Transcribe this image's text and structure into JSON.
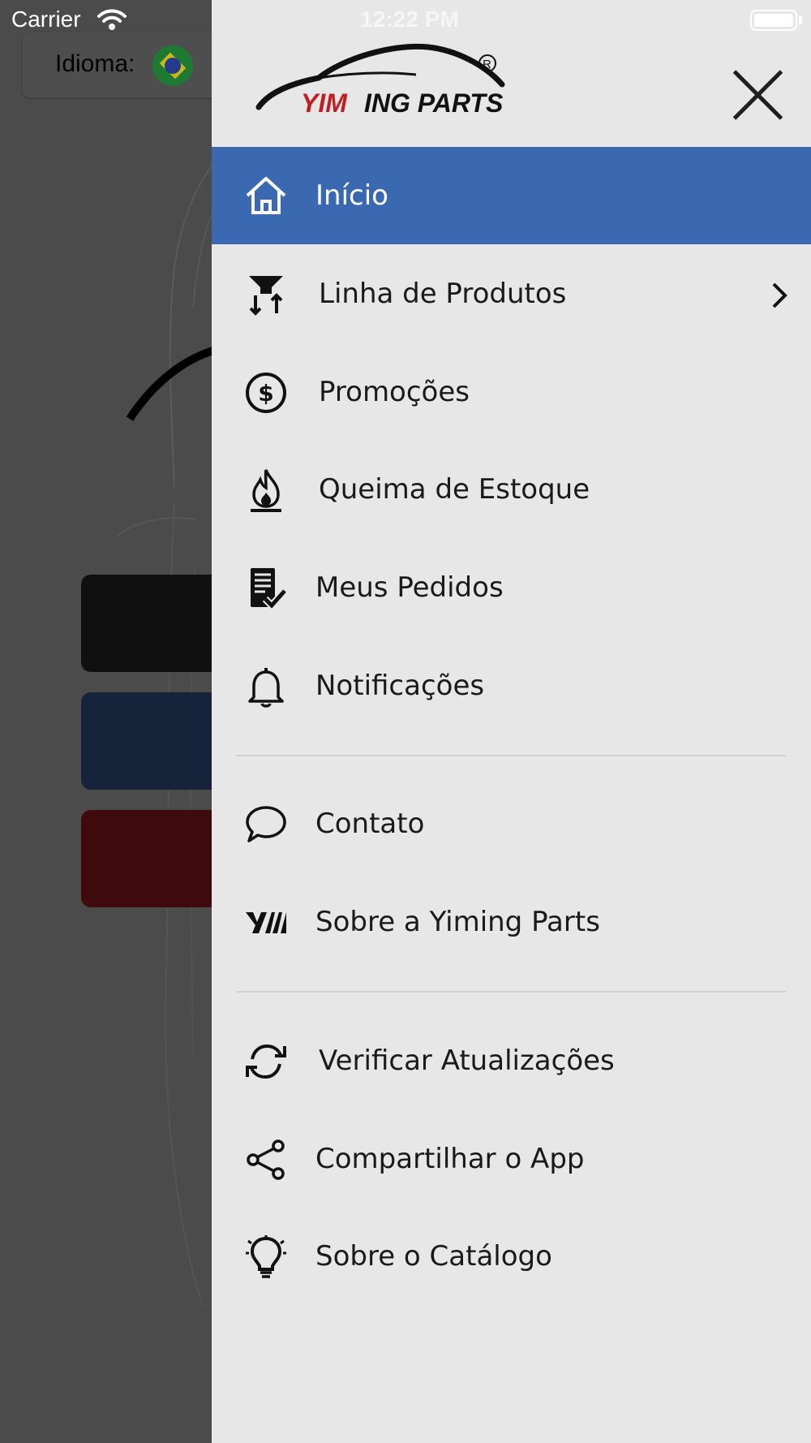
{
  "status_bar": {
    "carrier": "Carrier",
    "time": "12:22 PM"
  },
  "background": {
    "language_label": "Idioma:",
    "flag_icon": "brazil-flag-icon"
  },
  "drawer": {
    "logo_text": "YIMING PARTS",
    "logo_mark": "®",
    "close_icon": "close-icon",
    "items": [
      {
        "label": "Início",
        "icon": "home-icon",
        "active": true
      },
      {
        "label": "Linha de Produtos",
        "icon": "filter-sort-icon",
        "has_submenu": true
      },
      {
        "label": "Promoções",
        "icon": "dollar-circle-icon"
      },
      {
        "label": "Queima de Estoque",
        "icon": "flame-icon"
      },
      {
        "label": "Meus Pedidos",
        "icon": "checklist-icon"
      },
      {
        "label": "Notificações",
        "icon": "bell-icon"
      },
      {
        "label": "Contato",
        "icon": "chat-bubble-icon"
      },
      {
        "label": "Sobre a Yiming Parts",
        "icon": "ym-logo-icon"
      },
      {
        "label": "Verificar Atualizações",
        "icon": "refresh-icon"
      },
      {
        "label": "Compartilhar o App",
        "icon": "share-icon"
      },
      {
        "label": "Sobre o Catálogo",
        "icon": "lightbulb-icon"
      }
    ]
  },
  "colors": {
    "active_item": "#3b69b1",
    "drawer_bg": "#e7e7e7",
    "overlay_bg": "#4b4b4b"
  }
}
